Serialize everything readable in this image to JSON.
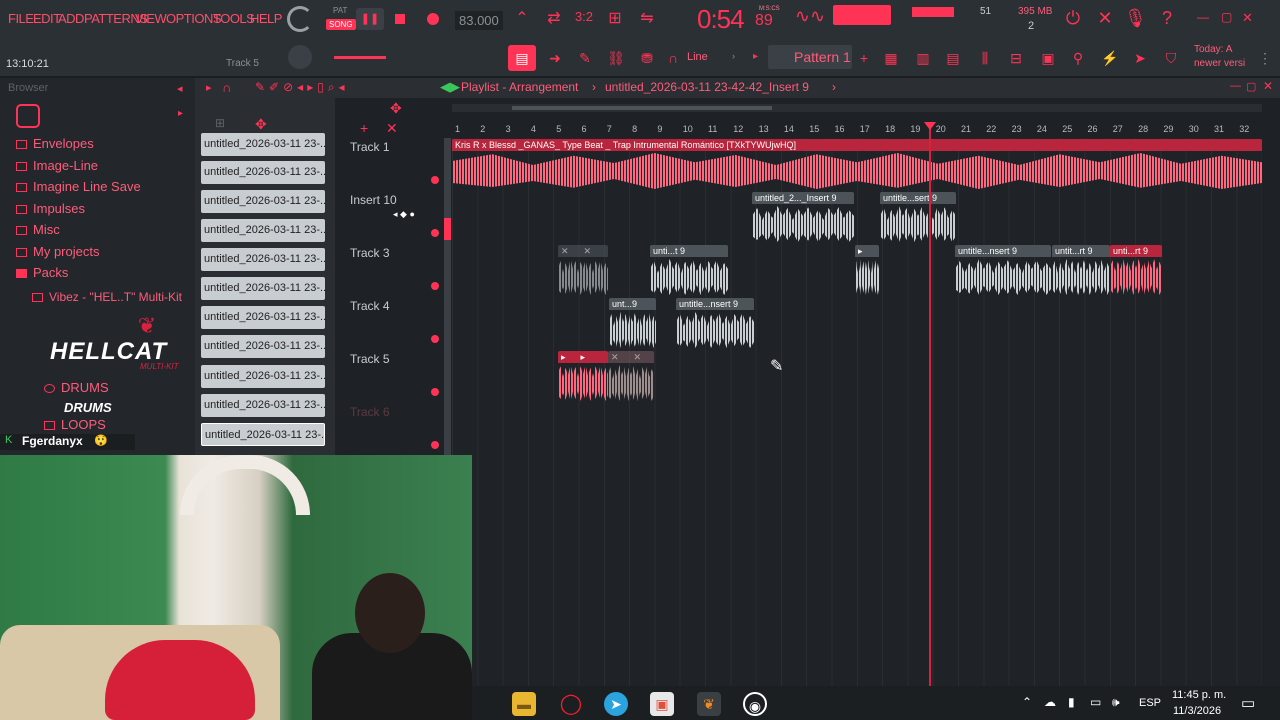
{
  "menu": {
    "items": [
      "FILE",
      "EDIT",
      "ADD",
      "PATTERNS",
      "VIEW",
      "OPTIONS",
      "TOOLS",
      "HELP"
    ]
  },
  "transport": {
    "pat_label": "PAT",
    "song_label": "SONG",
    "tempo": "83.000",
    "time": "0:54",
    "time_sub": "89",
    "time_unit": "M:S:CS",
    "cpu": "51",
    "memory": "395 MB",
    "voices": "2"
  },
  "toolbar": {
    "clock": "13:10:21",
    "track_label": "Track 5",
    "snap": "Line",
    "pattern": "Pattern 1",
    "hint_line1": "Today: A",
    "hint_line2": "newer versi"
  },
  "browser": {
    "title": "Browser",
    "items": [
      "Envelopes",
      "Image-Line",
      "Imagine Line Save",
      "Impulses",
      "Misc",
      "My projects",
      "Packs"
    ],
    "pack": "Vibez - \"HEL..T\" Multi-Kit",
    "logo": "HELLCAT",
    "logo_sub": "MULTI-KIT",
    "drums": "DRUMS",
    "drums2": "DRUMS",
    "loops": "LOOPS",
    "user": "Fgerdanyx"
  },
  "cliplist": [
    "untitled_2026-03-11 23-...",
    "untitled_2026-03-11 23-...",
    "untitled_2026-03-11 23-...",
    "untitled_2026-03-11 23-...",
    "untitled_2026-03-11 23-...",
    "untitled_2026-03-11 23-...",
    "untitled_2026-03-11 23-...",
    "untitled_2026-03-11 23-...",
    "untitled_2026-03-11 23-...",
    "untitled_2026-03-11 23-...",
    "untitled_2026-03-11 23-..."
  ],
  "playlist": {
    "title": "Playlist - Arrangement",
    "breadcrumb": "untitled_2026-03-11 23-42-42_Insert 9",
    "bars": [
      "1",
      "2",
      "3",
      "4",
      "5",
      "6",
      "7",
      "8",
      "9",
      "10",
      "11",
      "12",
      "13",
      "14",
      "15",
      "16",
      "17",
      "18",
      "19",
      "20",
      "21",
      "22",
      "23",
      "24",
      "25",
      "26",
      "27",
      "28",
      "29",
      "30",
      "31",
      "32"
    ],
    "tracks": [
      "Track 1",
      "Insert 10",
      "Track 3",
      "Track 4",
      "Track 5",
      "Track 6"
    ],
    "clip_main": "Kris R x Blessd _GANAS_ Type Beat _ Trap Intrumental Romántico [TXkTYWUjwHQ]",
    "clip_a": "untitled_2..._Insert 9",
    "clip_b": "untitle...sert 9",
    "clip_c": "unti...t 9",
    "clip_d": "untitle...nsert 9",
    "clip_e": "untit...rt 9",
    "clip_f": "unti...rt 9",
    "clip_g": "unt...9",
    "clip_h": "untitle...nsert 9"
  },
  "taskbar": {
    "lang": "ESP",
    "time": "11:45 p. m.",
    "date": "11/3/2026"
  }
}
